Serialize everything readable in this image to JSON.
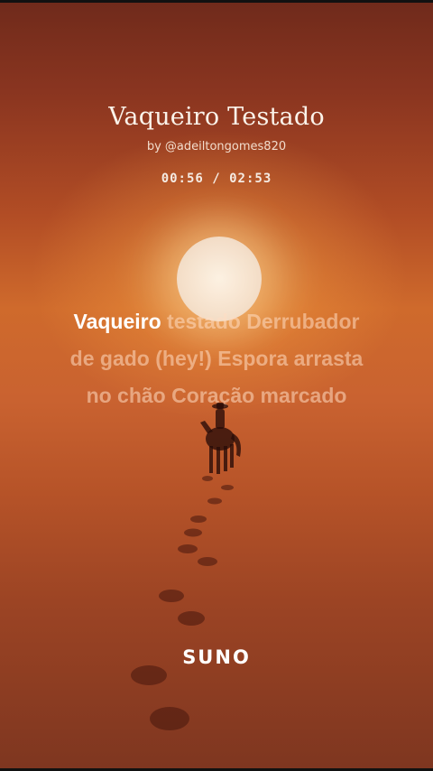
{
  "song": {
    "title": "Vaqueiro Testado",
    "artist": "by @adeiltongomes820",
    "time_display": "00:56 / 02:53"
  },
  "lyrics": {
    "active_word": "Vaqueiro",
    "rest_line1": " testado Derrubador",
    "line2": "de gado (hey!) Espora arrasta",
    "line3": "no chão Coração marcado"
  },
  "branding": {
    "logo": "SUNO"
  },
  "colors": {
    "background_top": "#6f2a1b",
    "background_mid": "#cf6a2c",
    "sun": "#f7e7d6",
    "text_active": "#ffffff",
    "text_inactive": "#ffdcc3"
  }
}
